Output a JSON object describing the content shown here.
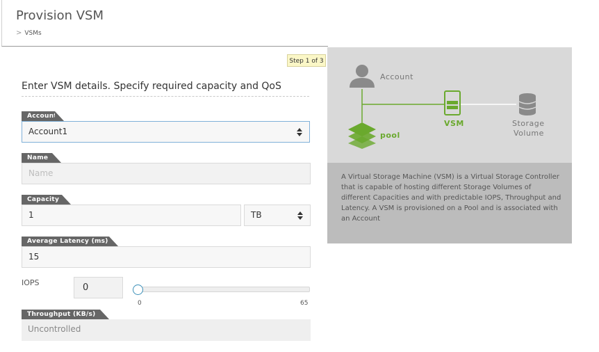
{
  "header": {
    "title": "Provision VSM",
    "breadcrumb": "VSMs"
  },
  "step": "Step 1 of 3",
  "section_title": "Enter VSM details. Specify required capacity and QoS",
  "form": {
    "account": {
      "label": "Account",
      "value": "Account1"
    },
    "name": {
      "label": "Name",
      "placeholder": "Name",
      "value": ""
    },
    "capacity": {
      "label": "Capacity",
      "value": "1",
      "unit": "TB"
    },
    "latency": {
      "label": "Average Latency (ms)",
      "value": "15"
    },
    "iops": {
      "label": "IOPS",
      "value": "0",
      "slider_min": "0",
      "slider_max": "65",
      "slider_level": 0
    },
    "throughput": {
      "label": "Throughput (KB/s)",
      "value": "Uncontrolled"
    }
  },
  "diagram": {
    "account_label": "Account",
    "pool_label": "pool",
    "vsm_label": "VSM",
    "storage_label_1": "Storage",
    "storage_label_2": "Volume",
    "accent_color": "#6aa92e"
  },
  "description": "A Virtual Storage Machine (VSM) is a Virtual Storage Controller that is capable of hosting different Storage Volumes of different Capacities and with predictable IOPS, Throughput and Latency. A VSM is provisioned on a Pool and is associated with an Account"
}
